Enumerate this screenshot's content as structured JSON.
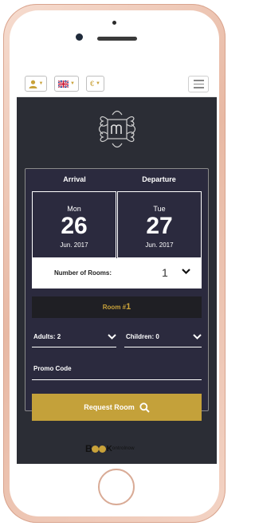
{
  "topbar": {
    "currency_label": "€",
    "icons": [
      "user-icon",
      "uk-flag-icon",
      "hamburger-menu-icon"
    ]
  },
  "booking": {
    "arrival_header": "Arrival",
    "departure_header": "Departure",
    "arrival": {
      "weekday": "Mon",
      "day": "26",
      "month_year": "Jun. 2017"
    },
    "departure": {
      "weekday": "Tue",
      "day": "27",
      "month_year": "Jun. 2017"
    },
    "rooms_label": "Number of Rooms:",
    "rooms_value": "1",
    "room_title": "Room #",
    "room_number": "1",
    "adults_label": "Adults: 2",
    "children_label": "Children: 0",
    "promo_placeholder": "Promo Code",
    "request_label": "Request Room"
  },
  "brand": {
    "prefix": "B",
    "k": "K",
    "rest": "ontrolnow"
  },
  "colors": {
    "accent": "#c4a13a",
    "screen_bg": "#2b2d35",
    "card_bg": "#2b2a3e"
  }
}
